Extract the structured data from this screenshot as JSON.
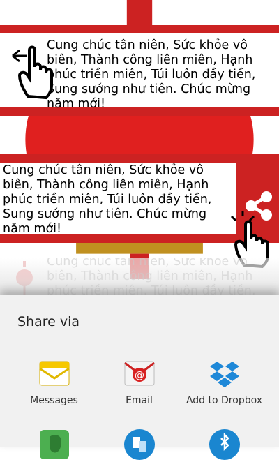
{
  "message": "Cung chúc tân niên, Sức khỏe vô biên, Thành công liên miên, Hạnh phúc triền miên, Túi luôn đầy tiền, Sung sướng như tiên. Chúc mừng năm mới!",
  "share_sheet": {
    "title": "Share via",
    "apps": [
      {
        "label": "Messages",
        "icon": "messages-icon"
      },
      {
        "label": "Email",
        "icon": "email-icon"
      },
      {
        "label": "Add to Dropbox",
        "icon": "dropbox-icon"
      },
      {
        "label": "",
        "icon": "evernote-icon"
      },
      {
        "label": "",
        "icon": "wifi-direct-icon"
      },
      {
        "label": "",
        "icon": "bluetooth-icon"
      }
    ]
  },
  "colors": {
    "brand_red": "#cc2222",
    "sheet_bg": "#f1f1f1"
  }
}
